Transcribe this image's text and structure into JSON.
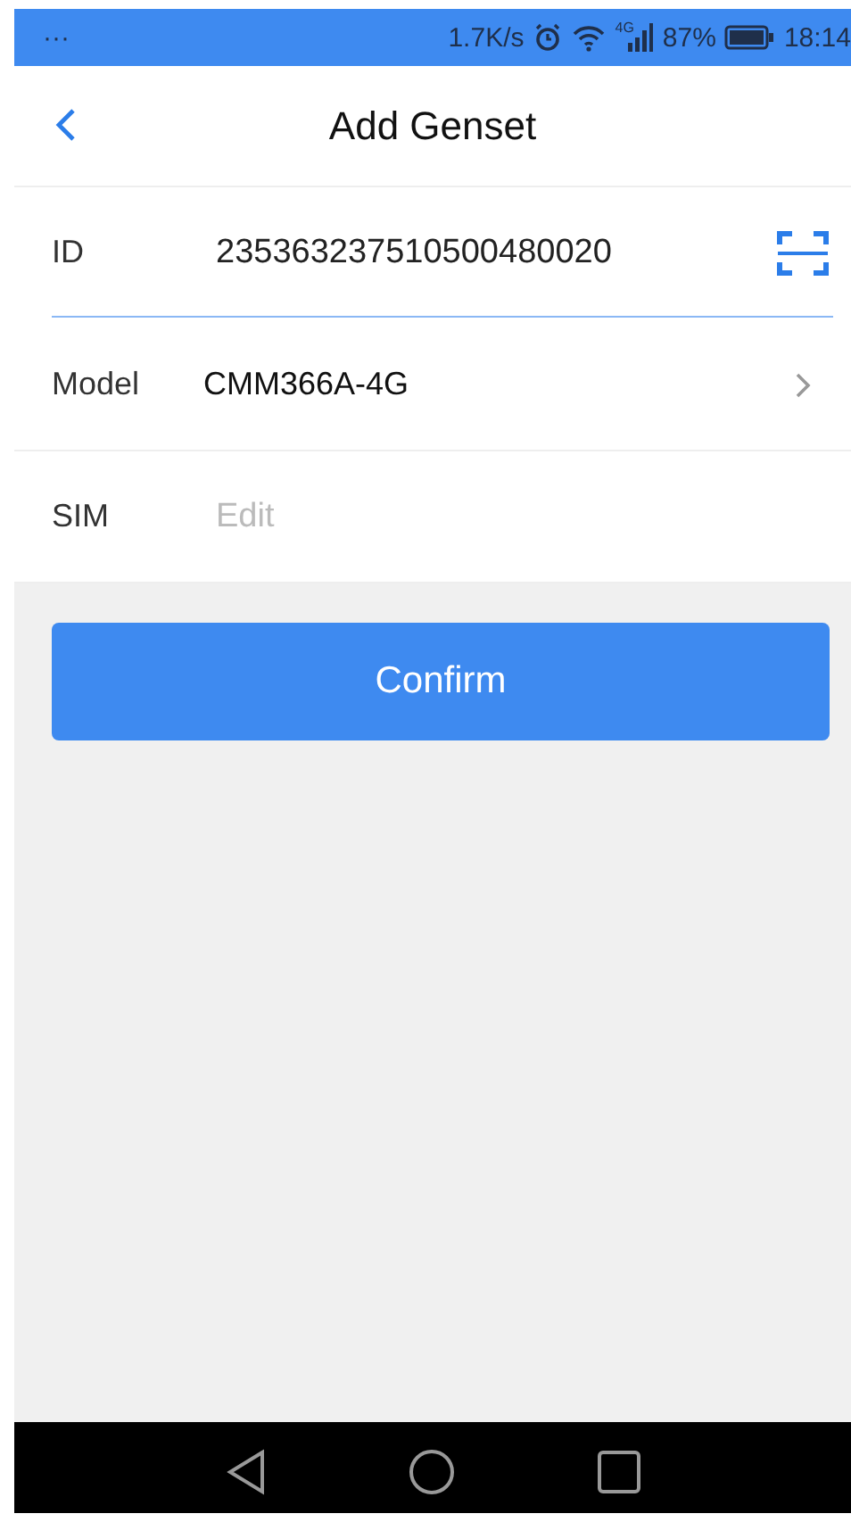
{
  "status_bar": {
    "menu": "···",
    "speed": "1.7K/s",
    "network": "4G",
    "battery": "87%",
    "time": "18:14"
  },
  "header": {
    "title": "Add Genset"
  },
  "form": [
    {
      "kind": "input",
      "label": "ID",
      "value": "235363237510500480020",
      "focused": true
    },
    {
      "kind": "select",
      "label": "Model",
      "value": "CMM366A-4G"
    },
    {
      "kind": "input",
      "label": "SIM",
      "placeholder": "Edit",
      "focused": false
    }
  ],
  "confirm_button": "Confirm"
}
